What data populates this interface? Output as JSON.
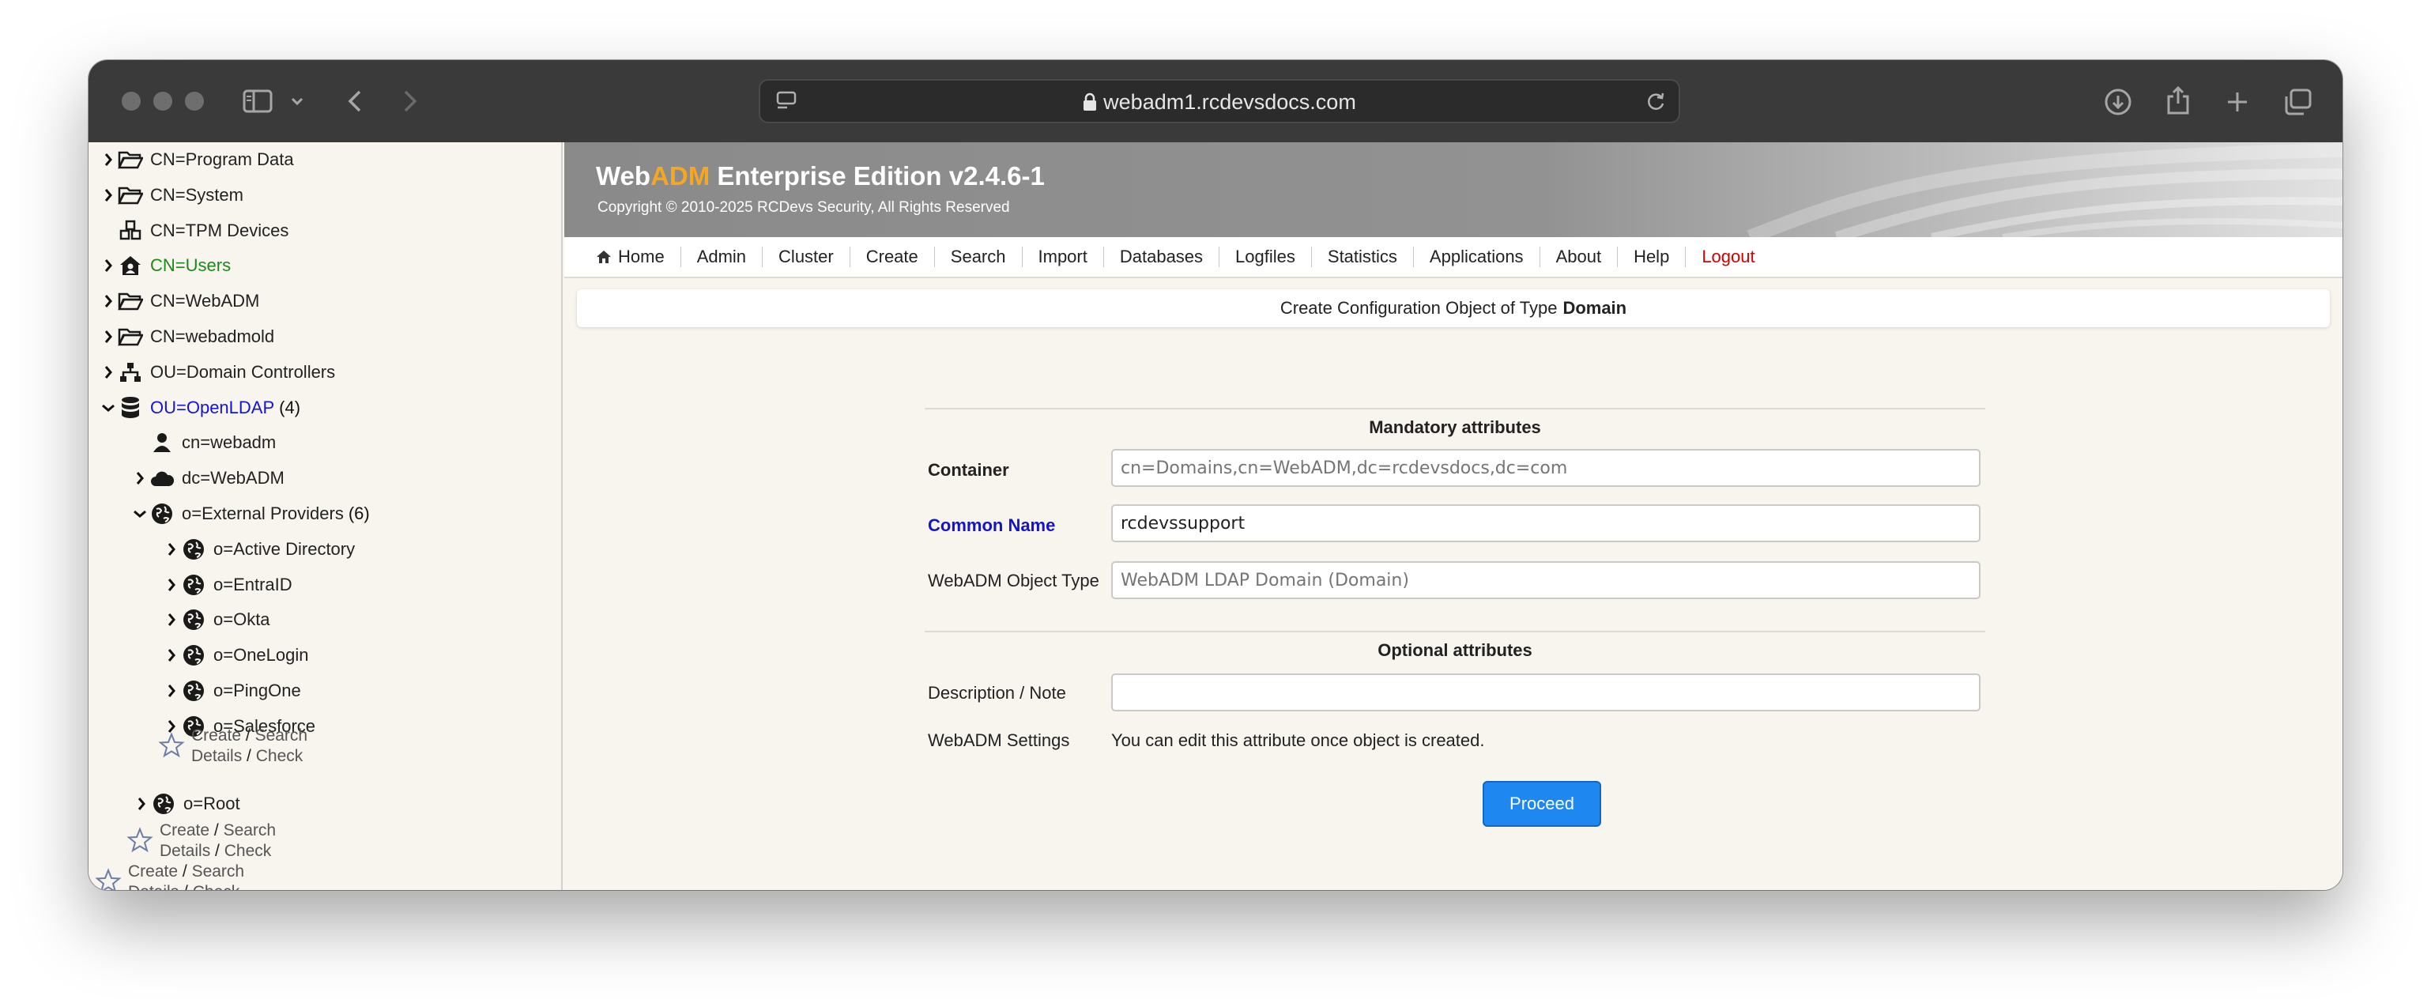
{
  "browser": {
    "url": "webadm1.rcdevsdocs.com"
  },
  "tree": {
    "items": [
      {
        "label": "CN=Program Data",
        "count": "",
        "icon": "folder-open-icon",
        "chevron": "right",
        "indent": 0,
        "style": ""
      },
      {
        "label": "CN=System",
        "count": "",
        "icon": "folder-open-icon",
        "chevron": "right",
        "indent": 0,
        "style": ""
      },
      {
        "label": "CN=TPM Devices",
        "count": "",
        "icon": "cubes-icon",
        "chevron": "",
        "indent": 0,
        "style": ""
      },
      {
        "label": "CN=Users",
        "count": "",
        "icon": "user-home-icon",
        "chevron": "right",
        "indent": 0,
        "style": "green"
      },
      {
        "label": "CN=WebADM",
        "count": "",
        "icon": "folder-open-icon",
        "chevron": "right",
        "indent": 0,
        "style": ""
      },
      {
        "label": "CN=webadmold",
        "count": "",
        "icon": "folder-open-icon",
        "chevron": "right",
        "indent": 0,
        "style": ""
      },
      {
        "label": "OU=Domain Controllers",
        "count": "",
        "icon": "sitemap-icon",
        "chevron": "right",
        "indent": 0,
        "style": ""
      },
      {
        "label": "OU=OpenLDAP",
        "count": "(4)",
        "icon": "database-icon",
        "chevron": "down",
        "indent": 0,
        "style": "blue"
      },
      {
        "label": "cn=webadm",
        "count": "",
        "icon": "user-icon",
        "chevron": "",
        "indent": 1,
        "style": ""
      },
      {
        "label": "dc=WebADM",
        "count": "",
        "icon": "cloud-icon",
        "chevron": "right",
        "indent": 1,
        "style": ""
      },
      {
        "label": "o=External Providers",
        "count": "(6)",
        "icon": "globe-icon",
        "chevron": "down",
        "indent": 1,
        "style": ""
      },
      {
        "label": "o=Active Directory",
        "count": "",
        "icon": "globe-icon",
        "chevron": "right",
        "indent": 2,
        "style": ""
      },
      {
        "label": "o=EntraID",
        "count": "",
        "icon": "globe-icon",
        "chevron": "right",
        "indent": 2,
        "style": ""
      },
      {
        "label": "o=Okta",
        "count": "",
        "icon": "globe-icon",
        "chevron": "right",
        "indent": 2,
        "style": ""
      },
      {
        "label": "o=OneLogin",
        "count": "",
        "icon": "globe-icon",
        "chevron": "right",
        "indent": 2,
        "style": ""
      },
      {
        "label": "o=PingOne",
        "count": "",
        "icon": "globe-icon",
        "chevron": "right",
        "indent": 2,
        "style": ""
      },
      {
        "label": "o=Salesforce",
        "count": "",
        "icon": "globe-icon",
        "chevron": "right",
        "indent": 2,
        "style": ""
      }
    ],
    "root_item": {
      "label": "o=Root",
      "icon": "globe-icon",
      "chevron": "right"
    },
    "action_links": {
      "create": "Create",
      "search": "Search",
      "details": "Details",
      "check": "Check",
      "separator": "/"
    }
  },
  "banner": {
    "title_prefix": "Web",
    "title_accent": "ADM",
    "title_rest": " Enterprise Edition v2.4.6-1",
    "copyright": "Copyright © 2010-2025 RCDevs Security, All Rights Reserved"
  },
  "menu": {
    "items": [
      "Home",
      "Admin",
      "Cluster",
      "Create",
      "Search",
      "Import",
      "Databases",
      "Logfiles",
      "Statistics",
      "Applications",
      "About",
      "Help"
    ],
    "logout": "Logout"
  },
  "page": {
    "heading_prefix": "Create Configuration Object of Type",
    "heading_type": "Domain"
  },
  "form": {
    "mandatory_title": "Mandatory attributes",
    "optional_title": "Optional attributes",
    "container_label": "Container",
    "container_placeholder": "cn=Domains,cn=WebADM,dc=rcdevsdocs,dc=com",
    "common_name_label": "Common Name",
    "common_name_value": "rcdevssupport",
    "object_type_label": "WebADM Object Type",
    "object_type_placeholder": "WebADM LDAP Domain (Domain)",
    "description_label": "Description / Note",
    "description_value": "",
    "settings_label": "WebADM Settings",
    "settings_text": "You can edit this attribute once object is created.",
    "proceed_label": "Proceed"
  },
  "colors": {
    "accent_orange": "#f5a623",
    "proceed_blue": "#1e88f0",
    "logout_red": "#d40000",
    "link_green": "#1a8a1a",
    "link_blue": "#1414d8"
  }
}
